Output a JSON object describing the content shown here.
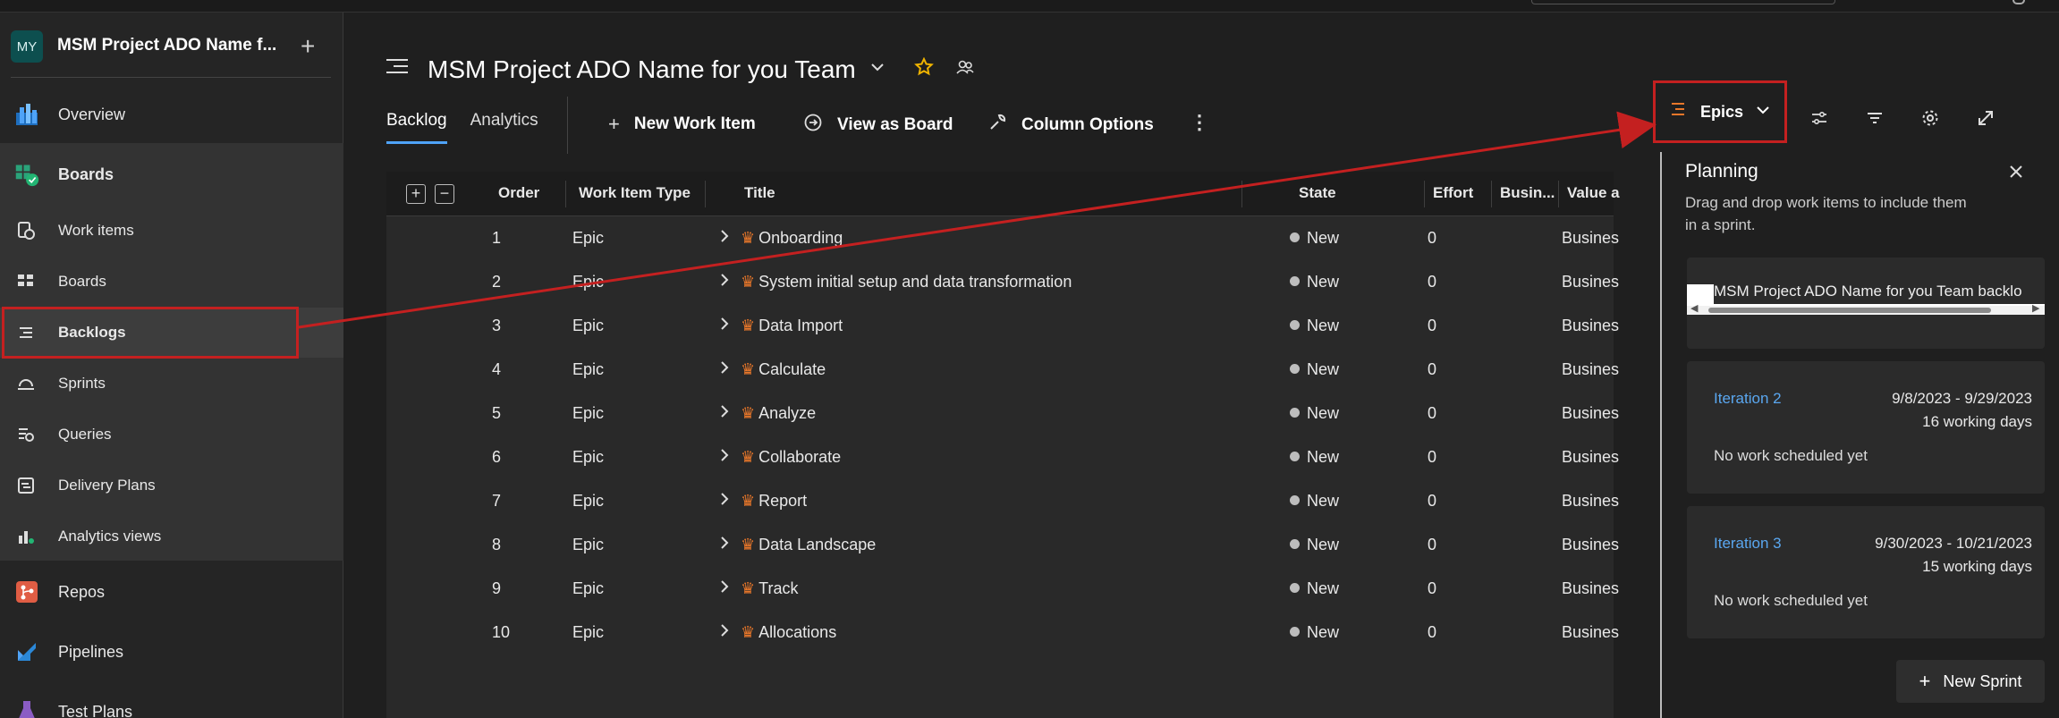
{
  "project": {
    "avatar_initials": "MY",
    "name": "MSM Project ADO Name f..."
  },
  "sidebar": {
    "items": [
      {
        "label": "Overview",
        "icon": "overview-icon"
      },
      {
        "label": "Boards",
        "icon": "boards-icon"
      },
      {
        "label": "Work items",
        "icon": "work-items-icon"
      },
      {
        "label": "Boards",
        "icon": "kanban-icon"
      },
      {
        "label": "Backlogs",
        "icon": "backlogs-icon"
      },
      {
        "label": "Sprints",
        "icon": "sprints-icon"
      },
      {
        "label": "Queries",
        "icon": "queries-icon"
      },
      {
        "label": "Delivery Plans",
        "icon": "delivery-plans-icon"
      },
      {
        "label": "Analytics views",
        "icon": "analytics-views-icon"
      },
      {
        "label": "Repos",
        "icon": "repos-icon"
      },
      {
        "label": "Pipelines",
        "icon": "pipelines-icon"
      },
      {
        "label": "Test Plans",
        "icon": "test-plans-icon"
      }
    ]
  },
  "header": {
    "team_title": "MSM Project ADO Name for you Team"
  },
  "tabs": {
    "backlog": "Backlog",
    "analytics": "Analytics"
  },
  "toolbar": {
    "new_work_item": "New Work Item",
    "view_as_board": "View as Board",
    "column_options": "Column Options",
    "level": "Epics"
  },
  "grid": {
    "columns": [
      "Order",
      "Work Item Type",
      "Title",
      "State",
      "Effort",
      "Busin...",
      "Value a"
    ],
    "rows": [
      {
        "order": "1",
        "type": "Epic",
        "title": "Onboarding",
        "state": "New",
        "effort": "0",
        "value_area": "Busines"
      },
      {
        "order": "2",
        "type": "Epic",
        "title": "System initial setup and data transformation",
        "state": "New",
        "effort": "0",
        "value_area": "Busines"
      },
      {
        "order": "3",
        "type": "Epic",
        "title": "Data Import",
        "state": "New",
        "effort": "0",
        "value_area": "Busines"
      },
      {
        "order": "4",
        "type": "Epic",
        "title": "Calculate",
        "state": "New",
        "effort": "0",
        "value_area": "Busines"
      },
      {
        "order": "5",
        "type": "Epic",
        "title": "Analyze",
        "state": "New",
        "effort": "0",
        "value_area": "Busines"
      },
      {
        "order": "6",
        "type": "Epic",
        "title": "Collaborate",
        "state": "New",
        "effort": "0",
        "value_area": "Busines"
      },
      {
        "order": "7",
        "type": "Epic",
        "title": "Report",
        "state": "New",
        "effort": "0",
        "value_area": "Busines"
      },
      {
        "order": "8",
        "type": "Epic",
        "title": "Data Landscape",
        "state": "New",
        "effort": "0",
        "value_area": "Busines"
      },
      {
        "order": "9",
        "type": "Epic",
        "title": "Track",
        "state": "New",
        "effort": "0",
        "value_area": "Busines"
      },
      {
        "order": "10",
        "type": "Epic",
        "title": "Allocations",
        "state": "New",
        "effort": "0",
        "value_area": "Busines"
      }
    ]
  },
  "planning": {
    "title": "Planning",
    "description": "Drag and drop work items to include them in a sprint.",
    "backlog_card": "MSM Project ADO Name for you Team backlo",
    "iterations": [
      {
        "name": "Iteration 2",
        "dates": "9/8/2023 - 9/29/2023",
        "days": "16 working days",
        "empty": "No work scheduled yet"
      },
      {
        "name": "Iteration 3",
        "dates": "9/30/2023 - 10/21/2023",
        "days": "15 working days",
        "empty": "No work scheduled yet"
      }
    ],
    "new_sprint": "New Sprint"
  },
  "colors": {
    "accent": "#4fa3f7",
    "epic": "#e8772a",
    "annotation": "#c42020"
  }
}
